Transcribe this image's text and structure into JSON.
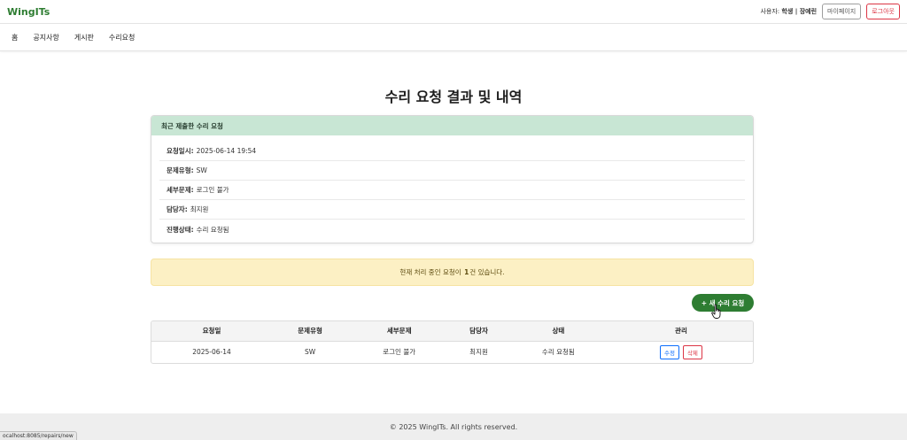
{
  "header": {
    "brand": "WingITs",
    "user_prefix": "사용자:",
    "user_role_name": "학생 | 장예린",
    "mypage_label": "마이페이지",
    "logout_label": "로그아웃"
  },
  "nav": {
    "items": [
      {
        "label": "홈"
      },
      {
        "label": "공지사항"
      },
      {
        "label": "게시판"
      },
      {
        "label": "수리요청"
      }
    ]
  },
  "page": {
    "title": "수리 요청 결과 및 내역"
  },
  "recent": {
    "header": "최근 제출한 수리 요청",
    "rows": [
      {
        "key": "요청일시:",
        "value": "2025-06-14 19:54"
      },
      {
        "key": "문제유형:",
        "value": "SW"
      },
      {
        "key": "세부문제:",
        "value": "로그인 불가"
      },
      {
        "key": "담당자:",
        "value": "최지원"
      },
      {
        "key": "진행상태:",
        "value": "수리 요청됨"
      }
    ]
  },
  "alert": {
    "prefix": "현재 처리 중인 요청이",
    "count": "1",
    "suffix": "건 있습니다."
  },
  "new_request_label": "+ 새 수리 요청",
  "table": {
    "columns": [
      "요청일",
      "문제유형",
      "세부문제",
      "담당자",
      "상태",
      "관리"
    ],
    "rows": [
      {
        "date": "2025-06-14",
        "type": "SW",
        "detail": "로그인 불가",
        "manager": "최지원",
        "status": "수리 요청됨",
        "edit": "수정",
        "delete": "삭제"
      }
    ]
  },
  "footer": {
    "text": "© 2025 WingITs. All rights reserved."
  },
  "status_bar_url": "ocalhost:8085/repairs/new",
  "colors": {
    "brand_green": "#2e7d32",
    "card_header_bg": "#c8e6d4",
    "alert_bg": "#fcf0c4",
    "danger": "#dc3545",
    "primary": "#0d6efd"
  }
}
